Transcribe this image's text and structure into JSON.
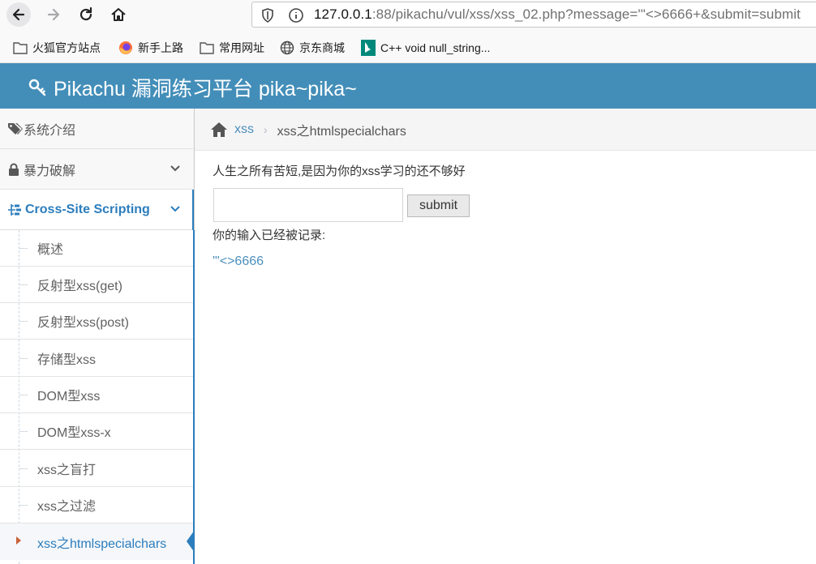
{
  "browser": {
    "url_host": "127.0.0.1",
    "url_rest": ":88/pikachu/vul/xss/xss_02.php?message='\"<>6666+&submit=submit",
    "bookmarks": [
      {
        "label": "火狐官方站点",
        "icon": "folder-icon"
      },
      {
        "label": "新手上路",
        "icon": "firefox-icon"
      },
      {
        "label": "常用网址",
        "icon": "folder-icon"
      },
      {
        "label": "京东商城",
        "icon": "globe-icon"
      },
      {
        "label": "C++ void null_string...",
        "icon": "bing-icon"
      }
    ]
  },
  "app": {
    "title": "Pikachu 漏洞练习平台 pika~pika~",
    "header_color": "#438eb9",
    "accent_color": "#2b7dbc"
  },
  "sidebar": {
    "items": [
      {
        "label": "系统介绍",
        "icon": "tags-icon"
      },
      {
        "label": "暴力破解",
        "icon": "lock-icon"
      },
      {
        "label": "Cross-Site Scripting",
        "icon": "list-tree-icon"
      }
    ],
    "subitems": [
      "概述",
      "反射型xss(get)",
      "反射型xss(post)",
      "存储型xss",
      "DOM型xss",
      "DOM型xss-x",
      "xss之盲打",
      "xss之过滤",
      "xss之htmlspecialchars"
    ]
  },
  "breadcrumb": {
    "link": "xss",
    "separator": "›",
    "current": "xss之htmlspecialchars"
  },
  "main": {
    "intro": "人生之所有苦短,是因为你的xss学习的还不够好",
    "input_value": "",
    "submit_label": "submit",
    "recorded_label": "你的输入已经被记录:",
    "recorded_value": "'\"<>6666"
  }
}
